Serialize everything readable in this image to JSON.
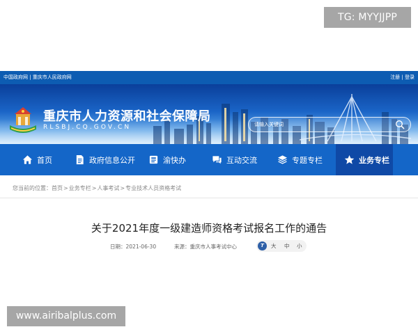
{
  "watermark_top": "TG: MYYJJPP",
  "watermark_bottom": "www.airibalplus.com",
  "top_bar": {
    "left_links": "中国政府网 | 重庆市人民政府网",
    "right_links": "注册 | 登录"
  },
  "site": {
    "title": "重庆市人力资源和社会保障局",
    "domain": "RLSBJ.CQ.GOV.CN"
  },
  "search": {
    "placeholder": "请输入关键词"
  },
  "nav": {
    "items": [
      {
        "label": "首页",
        "icon": "home-icon"
      },
      {
        "label": "政府信息公开",
        "icon": "document-icon"
      },
      {
        "label": "渝快办",
        "icon": "book-icon"
      },
      {
        "label": "互动交流",
        "icon": "chat-icon"
      },
      {
        "label": "专题专栏",
        "icon": "layers-icon"
      },
      {
        "label": "业务专栏",
        "icon": "star-icon",
        "active": true
      }
    ]
  },
  "breadcrumb": {
    "prefix": "您当前的位置：",
    "items": [
      "首页",
      "业务专栏",
      "人事考试",
      "专业技术人员资格考试"
    ],
    "separator": ">"
  },
  "article": {
    "title": "关于2021年度一级建造师资格考试报名工作的通告",
    "date": "日期：2021-06-30",
    "source": "来源：重庆市人事考试中心",
    "font_size": {
      "icon_glyph": "T",
      "options": [
        "大",
        "中",
        "小"
      ]
    }
  },
  "colors": {
    "top_bar": "#0d5cb2",
    "nav": "#1466c8",
    "nav_active": "#0f49a6",
    "watermark": "#a6a6a6"
  }
}
